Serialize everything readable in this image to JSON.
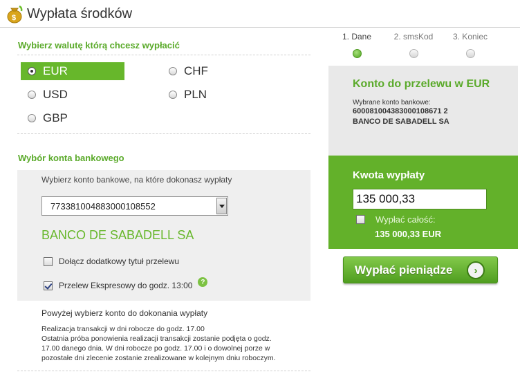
{
  "header": {
    "title": "Wypłata środków",
    "logo_icon": "money-bag-icon"
  },
  "currency_section": {
    "title": "Wybierz walutę którą chcesz wypłacić",
    "options": [
      {
        "label": "EUR",
        "selected": true
      },
      {
        "label": "CHF",
        "selected": false
      },
      {
        "label": "USD",
        "selected": false
      },
      {
        "label": "PLN",
        "selected": false
      },
      {
        "label": "GBP",
        "selected": false
      }
    ]
  },
  "bank_section": {
    "title": "Wybór konta bankowego",
    "hint": "Wybierz konto bankowe, na które dokonasz wypłaty",
    "selected_account": "773381004883000108552",
    "bank_name": "BANCO DE SABADELL SA",
    "extra_title_label": "Dołącz dodatkowy tytuł przelewu",
    "extra_title_checked": false,
    "express_label": "Przelew Ekspresowy do godz. 13:00",
    "express_checked": true,
    "help_glyph": "?"
  },
  "notes": {
    "primary": "Powyżej wybierz konto do dokonania wypłaty",
    "lines": [
      "Realizacja transakcji w dni robocze do godz. 17.00",
      "Ostatnia próba ponowienia realizacji transakcji zostanie podjęta o godz.",
      "17.00 danego dnia. W dni robocze po godz. 17.00 i o dowolnej porze w",
      "pozostałe dni zlecenie zostanie zrealizowane w kolejnym dniu roboczym."
    ]
  },
  "steps": [
    {
      "label": "1. Dane",
      "active": true
    },
    {
      "label": "2. smsKod",
      "active": false
    },
    {
      "label": "3. Koniec",
      "active": false
    }
  ],
  "account_panel": {
    "title": "Konto do przelewu w EUR",
    "chosen_label": "Wybrane konto bankowe:",
    "account_number": "600081004383000108671 2",
    "bank": "BANCO DE SABADELL SA"
  },
  "amount_panel": {
    "title": "Kwota wypłaty",
    "amount_value": "135 000,33",
    "withdraw_all_label": "Wypłać całość:",
    "withdraw_all_checked": false,
    "total": "135 000,33 EUR"
  },
  "pay_button": {
    "label": "Wypłać pieniądze",
    "arrow_glyph": "›"
  },
  "colors": {
    "accent_green": "#67b72b",
    "title_green": "#5aaa2a",
    "panel_gray": "#efefef"
  }
}
